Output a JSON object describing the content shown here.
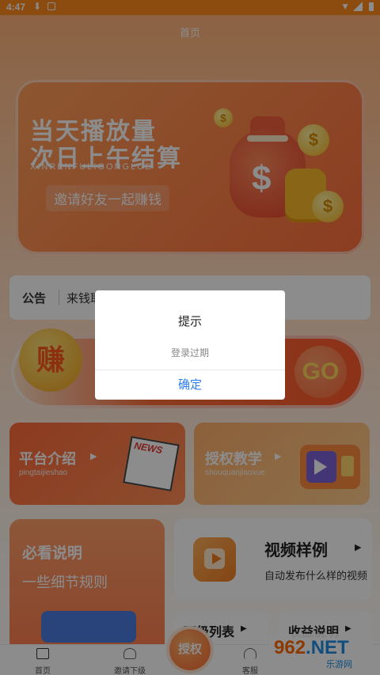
{
  "status_bar": {
    "time": "4:47"
  },
  "header": {
    "title": "首页"
  },
  "banner": {
    "line1": "当天播放量",
    "line2": "次日上午结算",
    "pinyin": "XINRENFULIGONGLUE",
    "cta": "邀请好友一起赚钱",
    "coin_symbol": "$"
  },
  "notice": {
    "tag": "公告",
    "text": "来钱耶"
  },
  "activity": {
    "left_badge": "赚",
    "go_button": "GO"
  },
  "cards": {
    "platform": {
      "title": "平台介绍",
      "subtitle": "pingtaijieshao",
      "image_text": "NEWS"
    },
    "tutorial": {
      "title": "授权教学",
      "subtitle": "shouquanjiaoxue"
    },
    "must_read": {
      "title": "必看说明",
      "subtitle": "一些细节规则"
    },
    "video_sample": {
      "title": "视频样例",
      "subtitle": "自动发布什么样的视频"
    },
    "sub_list": {
      "title": "下级列表"
    },
    "income": {
      "title": "收益说明"
    }
  },
  "tabbar": {
    "home": "首页",
    "invite": "邀请下级",
    "center": "授权",
    "service": "客服"
  },
  "watermark": {
    "brand_a": "962",
    "brand_b": ".NET",
    "site": "乐游网"
  },
  "dialog": {
    "title": "提示",
    "message": "登录过期",
    "confirm": "确定"
  },
  "colors": {
    "accent": "#ff8a1e",
    "link": "#2a7ff0"
  }
}
